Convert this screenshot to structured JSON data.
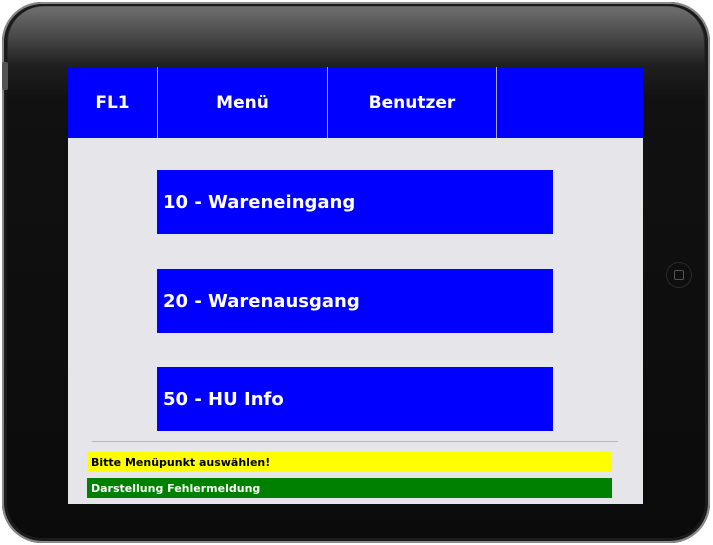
{
  "header": {
    "tabs": [
      {
        "label": "FL1"
      },
      {
        "label": "Menü"
      },
      {
        "label": "Benutzer"
      },
      {
        "label": ""
      }
    ]
  },
  "menu": {
    "items": [
      {
        "label": "10 - Wareneingang"
      },
      {
        "label": "20 - Warenausgang"
      },
      {
        "label": "50 - HU Info"
      }
    ]
  },
  "status": {
    "prompt": "Bitte Menüpunkt auswählen!",
    "error": "Darstellung Fehlermeldung"
  },
  "colors": {
    "primary": "#0000ff",
    "screen_background": "#e6e6ea",
    "prompt_background": "#ffff00",
    "error_background": "#008000"
  },
  "icons": {
    "home_button": "home-button-icon"
  }
}
